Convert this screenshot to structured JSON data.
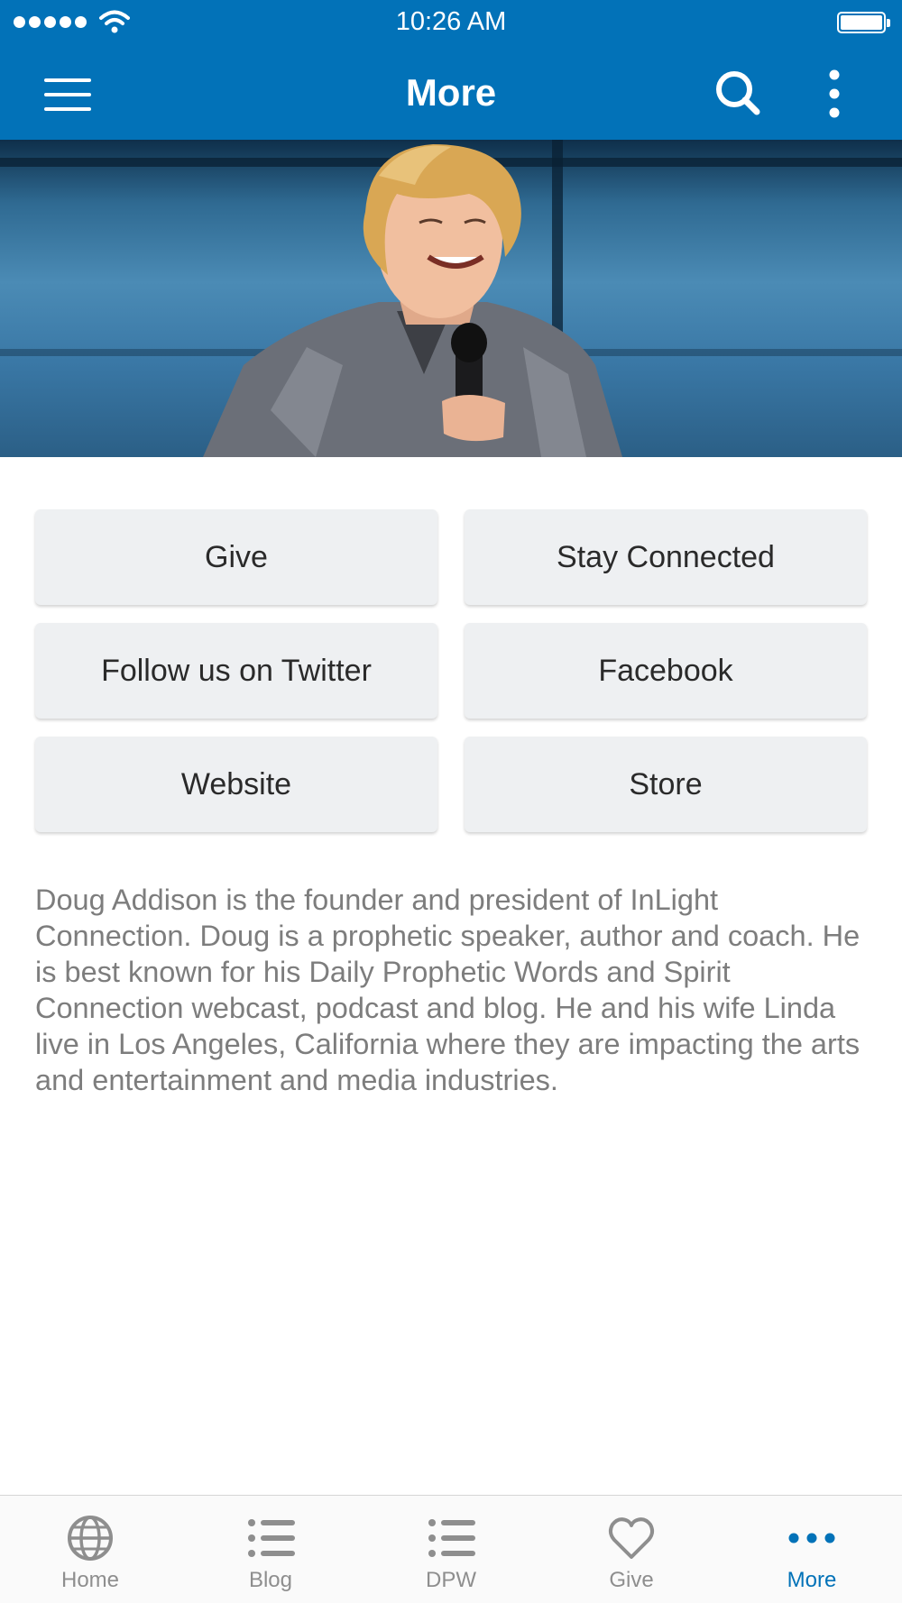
{
  "status_bar": {
    "time": "10:26 AM",
    "signal_icon": "signal-dots-icon",
    "wifi_icon": "wifi-icon",
    "battery_icon": "battery-icon"
  },
  "header": {
    "title": "More",
    "menu_icon": "hamburger-menu-icon",
    "search_icon": "search-icon",
    "more_icon": "vertical-dots-icon",
    "background": "#0272b8"
  },
  "hero": {
    "description": "Photo of a smiling speaker with light blond hair holding a microphone in front of a blue backdrop"
  },
  "buttons": [
    {
      "label": "Give"
    },
    {
      "label": "Stay Connected"
    },
    {
      "label": "Follow us on Twitter"
    },
    {
      "label": "Facebook"
    },
    {
      "label": "Website"
    },
    {
      "label": "Store"
    }
  ],
  "bio": "Doug Addison is the founder and president of InLight Connection. Doug is a prophetic speaker, author and coach. He is best known for his Daily Prophetic Words and Spirit Connection webcast, podcast and blog. He and his wife Linda live in Los Angeles, California where they are impacting the arts and entertainment and media industries.",
  "tabs": [
    {
      "label": "Home",
      "icon": "globe-icon",
      "active": false
    },
    {
      "label": "Blog",
      "icon": "list-icon",
      "active": false
    },
    {
      "label": "DPW",
      "icon": "list-icon",
      "active": false
    },
    {
      "label": "Give",
      "icon": "heart-icon",
      "active": false
    },
    {
      "label": "More",
      "icon": "horizontal-dots-icon",
      "active": true
    }
  ],
  "colors": {
    "accent": "#0272b8",
    "tab_inactive": "#8e8e8e",
    "button_bg": "#eef0f2",
    "bio_text": "#7d7d7d"
  }
}
